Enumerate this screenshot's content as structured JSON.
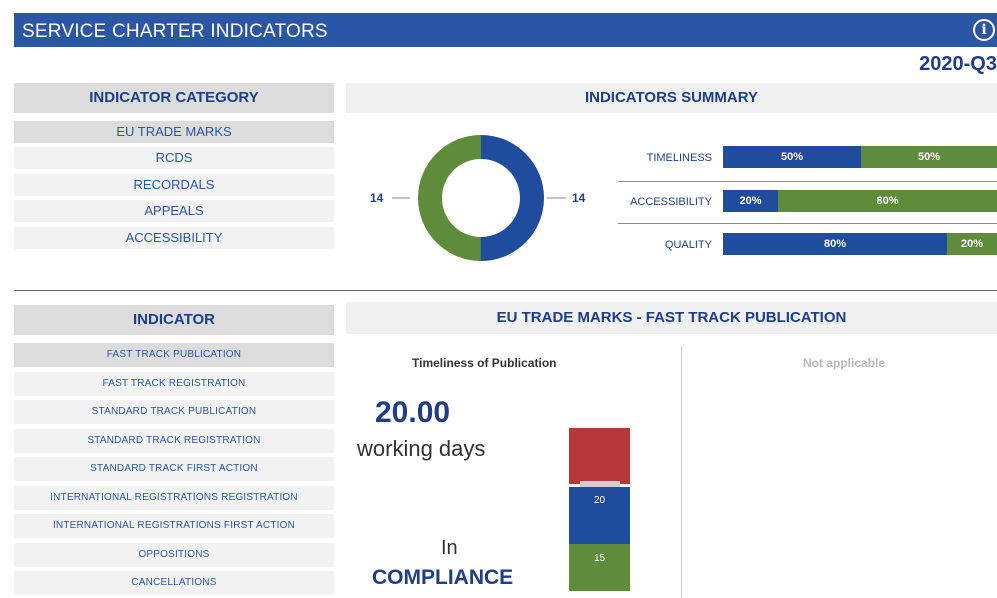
{
  "header": {
    "title": "SERVICE CHARTER INDICATORS",
    "info_icon": "info-icon",
    "period": "2020-Q3"
  },
  "colors": {
    "blue": "#1f4c9c",
    "green": "#5e8c3a",
    "red": "#b5383a",
    "header_bar": "#2b56a6"
  },
  "category_panel": {
    "header": "INDICATOR CATEGORY",
    "items": [
      "EU TRADE MARKS",
      "RCDS",
      "RECORDALS",
      "APPEALS",
      "ACCESSIBILITY"
    ],
    "selected": "EU TRADE MARKS"
  },
  "summary_panel": {
    "header": "INDICATORS SUMMARY",
    "donut": {
      "left_label": "14",
      "right_label": "14",
      "blue_value": 14,
      "green_value": 14
    },
    "bars": [
      {
        "label": "TIMELINESS",
        "blue_pct": 50,
        "green_pct": 50,
        "blue_text": "50%",
        "green_text": "50%"
      },
      {
        "label": "ACCESSIBILITY",
        "blue_pct": 20,
        "green_pct": 80,
        "blue_text": "20%",
        "green_text": "80%"
      },
      {
        "label": "QUALITY",
        "blue_pct": 80,
        "green_pct": 20,
        "blue_text": "80%",
        "green_text": "20%"
      }
    ]
  },
  "indicator_panel": {
    "header": "INDICATOR",
    "items": [
      "FAST TRACK PUBLICATION",
      "FAST TRACK REGISTRATION",
      "STANDARD TRACK PUBLICATION",
      "STANDARD TRACK REGISTRATION",
      "STANDARD TRACK FIRST ACTION",
      "INTERNATIONAL REGISTRATIONS REGISTRATION",
      "INTERNATIONAL REGISTRATIONS FIRST ACTION",
      "OPPOSITIONS",
      "CANCELLATIONS"
    ],
    "selected": "FAST TRACK PUBLICATION"
  },
  "detail_panel": {
    "header": "EU TRADE MARKS - FAST TRACK PUBLICATION",
    "subtitle": "Timeliness of Publication",
    "value": "20.00",
    "unit": "working days",
    "status_line1": "In",
    "status_line2": "COMPLIANCE",
    "gauge": {
      "upper_threshold": "20",
      "lower_threshold": "15"
    },
    "right_text": "Not applicable"
  }
}
